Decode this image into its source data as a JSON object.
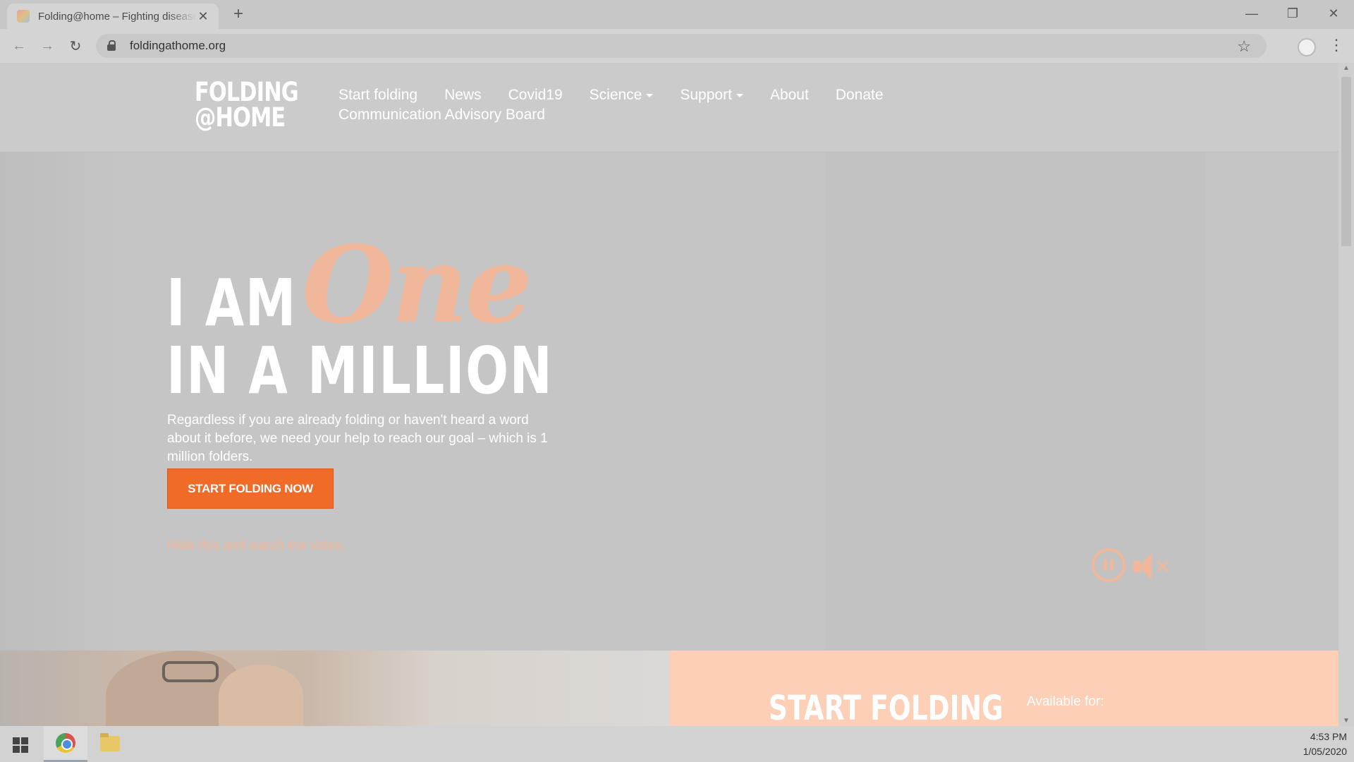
{
  "browser": {
    "tab_title": "Folding@home – Fighting disease",
    "new_tab_icon": "plus-icon",
    "url": "foldingathome.org",
    "window_controls": [
      "minimize-icon",
      "restore-icon",
      "close-icon"
    ]
  },
  "site": {
    "logo_line1": "FOLDING",
    "logo_line2": "@HOME",
    "nav": [
      {
        "label": "Start folding"
      },
      {
        "label": "News"
      },
      {
        "label": "Covid19"
      },
      {
        "label": "Science"
      },
      {
        "label": "Support"
      },
      {
        "label": "About"
      },
      {
        "label": "Donate"
      },
      {
        "label": "Communication Advisory Board"
      }
    ]
  },
  "hero": {
    "line1": "I AM",
    "script_word": "One",
    "line2": "IN A MILLION",
    "description": "Regardless if you are already folding or haven't heard a word about it before, we need your help to reach our goal – which is 1 million folders.",
    "cta_label": "START FOLDING NOW",
    "hide_link": "Hide this and watch the video."
  },
  "bottom": {
    "start_folding_title": "START FOLDING",
    "available_for": "Available for:"
  },
  "taskbar": {
    "time": "4:53 PM",
    "date": "1/05/2020"
  },
  "colors": {
    "accent_orange": "#f06a28",
    "salmon": "#fdcfb6",
    "script_peach": "#f0b79a"
  }
}
